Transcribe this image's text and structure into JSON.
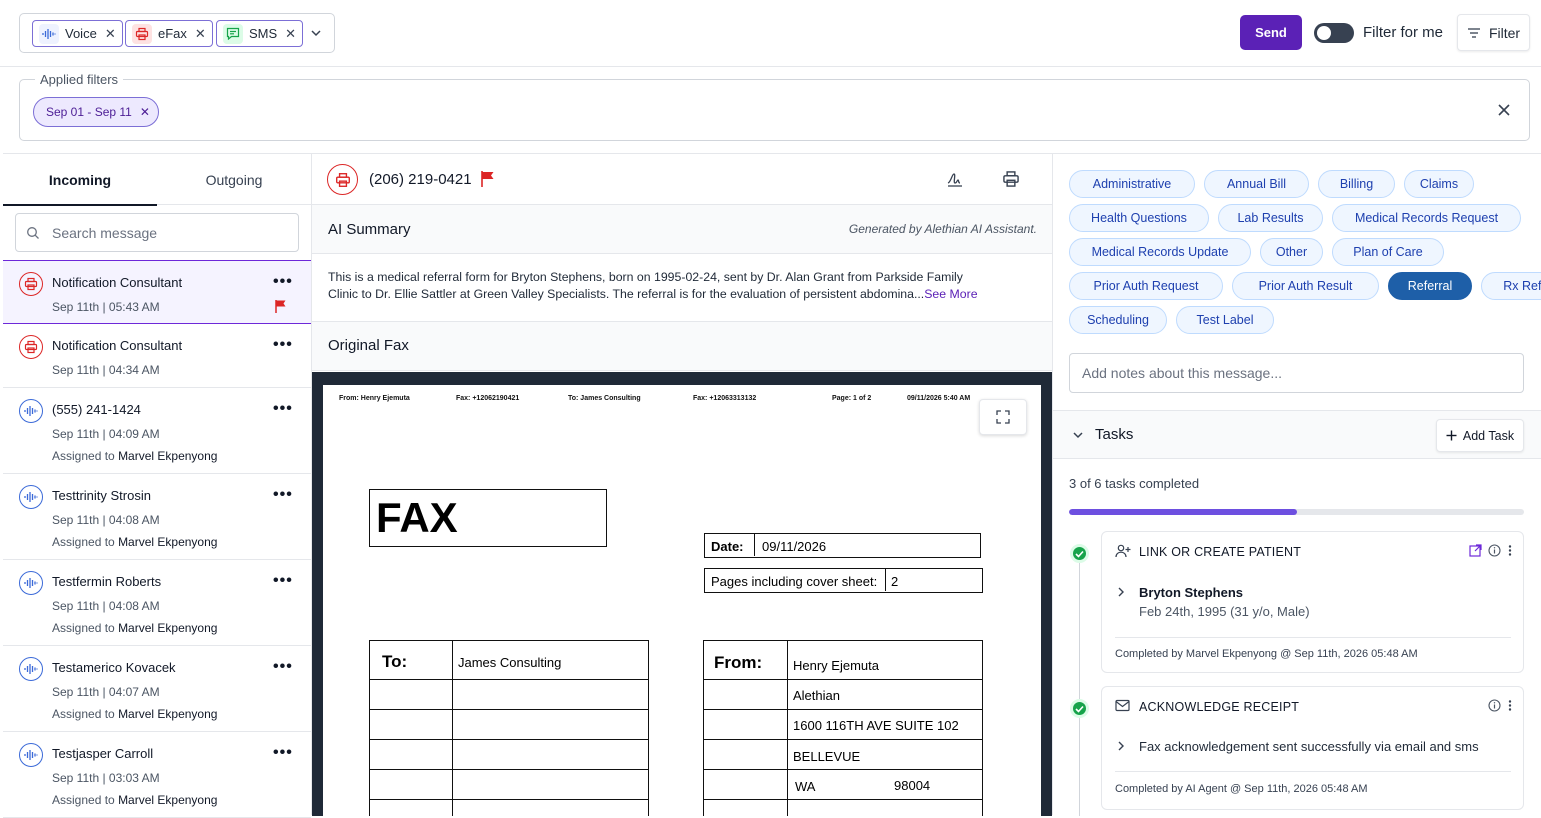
{
  "channels": [
    {
      "label": "Voice",
      "icon": "waveform-icon"
    },
    {
      "label": "eFax",
      "icon": "printer-icon"
    },
    {
      "label": "SMS",
      "icon": "chat-icon"
    }
  ],
  "topbar": {
    "send_label": "Send",
    "filter_for_me": "Filter for me",
    "filter_label": "Filter"
  },
  "applied_filters": {
    "legend": "Applied filters",
    "chips": [
      "Sep 01 - Sep 11"
    ]
  },
  "left": {
    "tabs": [
      "Incoming",
      "Outgoing"
    ],
    "search_placeholder": "Search message",
    "assigned_prefix": "Assigned to",
    "messages": [
      {
        "name": "Notification Consultant",
        "time": "Sep 11th | 05:43 AM",
        "type": "fax",
        "assigned": "",
        "flag": true,
        "selected": true
      },
      {
        "name": "Notification Consultant",
        "time": "Sep 11th | 04:34 AM",
        "type": "fax",
        "assigned": "",
        "flag": false,
        "selected": false
      },
      {
        "name": "(555) 241-1424",
        "time": "Sep 11th | 04:09 AM",
        "type": "voice",
        "assigned": "Marvel Ekpenyong",
        "flag": false,
        "selected": false
      },
      {
        "name": "Testtrinity Strosin",
        "time": "Sep 11th | 04:08 AM",
        "type": "voice",
        "assigned": "Marvel Ekpenyong",
        "flag": false,
        "selected": false
      },
      {
        "name": "Testfermin Roberts",
        "time": "Sep 11th | 04:08 AM",
        "type": "voice",
        "assigned": "Marvel Ekpenyong",
        "flag": false,
        "selected": false
      },
      {
        "name": "Testamerico Kovacek",
        "time": "Sep 11th | 04:07 AM",
        "type": "voice",
        "assigned": "Marvel Ekpenyong",
        "flag": false,
        "selected": false
      },
      {
        "name": "Testjasper Carroll",
        "time": "Sep 11th | 03:03 AM",
        "type": "voice",
        "assigned": "Marvel Ekpenyong",
        "flag": false,
        "selected": false
      }
    ]
  },
  "middle": {
    "phone": "(206) 219-0421",
    "ai_title": "AI Summary",
    "ai_generated": "Generated by Alethian AI Assistant.",
    "ai_line1": "This is a medical referral form for Bryton Stephens, born on 1995-02-24, sent by Dr. Alan Grant from Parkside Family",
    "ai_line2": "Clinic to Dr. Ellie Sattler at Green Valley Specialists. The referral is for the evaluation of persistent abdomina...",
    "see_more": "See More",
    "original_title": "Original Fax",
    "fax": {
      "top_from": "From: Henry Ejemuta",
      "top_fax": "Fax: +12062190421",
      "top_to": "To: James Consulting",
      "top_fax2": "Fax: +12063313132",
      "top_page": "Page: 1 of 2",
      "top_date": "09/11/2026 5:40 AM",
      "title": "FAX",
      "date_label": "Date:",
      "date_value": "09/11/2026",
      "pages_label": "Pages including cover sheet:",
      "pages_value": "2",
      "to_label": "To:",
      "to_value": "James Consulting",
      "from_label": "From:",
      "from_lines": [
        "Henry Ejemuta",
        "Alethian",
        "1600 116TH AVE SUITE 102",
        "BELLEVUE"
      ],
      "from_state": "WA",
      "from_zip": "98004"
    }
  },
  "right": {
    "labels": [
      "Administrative",
      "Annual Bill",
      "Billing",
      "Claims",
      "Health Questions",
      "Lab Results",
      "Medical Records Request",
      "Medical Records Update",
      "Other",
      "Plan of Care",
      "Prior Auth Request",
      "Prior Auth Result",
      "Referral",
      "Rx Refill",
      "Scheduling",
      "Test Label"
    ],
    "selected_label": "Referral",
    "notes_placeholder": "Add notes about this message...",
    "tasks_title": "Tasks",
    "add_task": "Add Task",
    "progress_text": "3 of 6 tasks completed",
    "progress_fraction": 0.5,
    "tasks": [
      {
        "title": "LINK OR CREATE PATIENT",
        "detail": "Bryton Stephens",
        "detail2": "Feb 24th, 1995 (31 y/o, Male)",
        "completed": "Completed by Marvel Ekpenyong @ Sep 11th, 2026 05:48 AM"
      },
      {
        "title": "ACKNOWLEDGE RECEIPT",
        "detail": "Fax acknowledgement sent successfully via email and sms",
        "completed": "Completed by AI Agent @ Sep 11th, 2026 05:48 AM"
      }
    ]
  }
}
